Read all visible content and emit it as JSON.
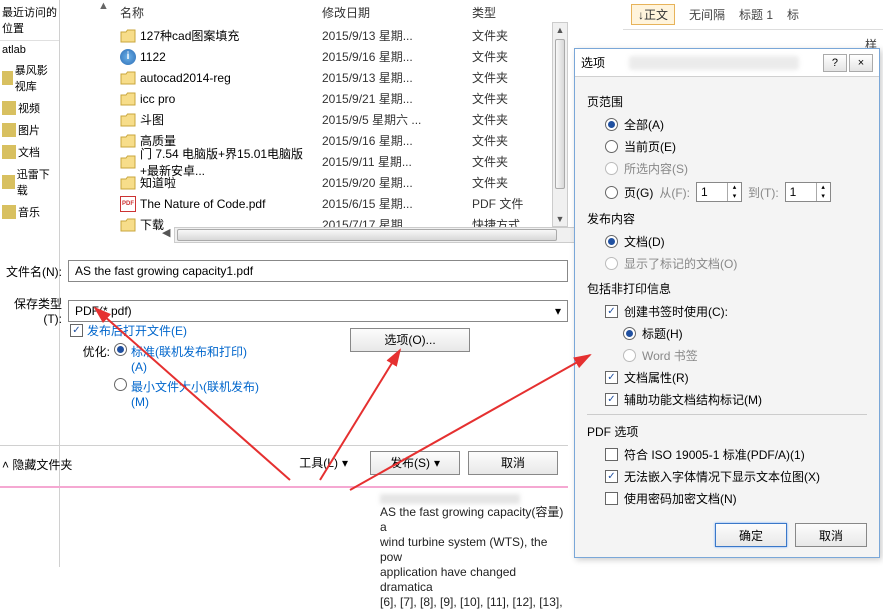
{
  "left_nav": {
    "header": "最近访问的位置",
    "items": [
      "atlab",
      "暴风影视库",
      "视频",
      "图片",
      "文档",
      "迅雷下载",
      "音乐"
    ]
  },
  "file_list": {
    "cols": {
      "name": "名称",
      "date": "修改日期",
      "type": "类型"
    },
    "rows": [
      {
        "name": "127种cad图案填充",
        "date": "2015/9/13 星期...",
        "type": "文件夹",
        "icon": "folder"
      },
      {
        "name": "1122",
        "date": "2015/9/16 星期...",
        "type": "文件夹",
        "icon": "info"
      },
      {
        "name": "autocad2014-reg",
        "date": "2015/9/13 星期...",
        "type": "文件夹",
        "icon": "folder"
      },
      {
        "name": "icc pro",
        "date": "2015/9/21 星期...",
        "type": "文件夹",
        "icon": "folder"
      },
      {
        "name": "斗图",
        "date": "2015/9/5 星期六 ...",
        "type": "文件夹",
        "icon": "folder"
      },
      {
        "name": "高质量",
        "date": "2015/9/16 星期...",
        "type": "文件夹",
        "icon": "folder"
      },
      {
        "name": "门 7.54 电脑版+界15.01电脑版+最新安卓...",
        "date": "2015/9/11 星期...",
        "type": "文件夹",
        "icon": "folder"
      },
      {
        "name": "知道啦",
        "date": "2015/9/20 星期...",
        "type": "文件夹",
        "icon": "folder"
      },
      {
        "name": "The Nature of Code.pdf",
        "date": "2015/6/15 星期...",
        "type": "PDF 文件",
        "icon": "pdf"
      },
      {
        "name": "下载",
        "date": "2015/7/17 星期",
        "type": "快捷方式",
        "icon": "folder"
      }
    ]
  },
  "filename": {
    "label": "文件名(N):",
    "value": "AS the fast growing capacity1.pdf"
  },
  "filetype": {
    "label": "保存类型(T):",
    "value": "PDF(*.pdf)"
  },
  "save_opts": {
    "open_after": "发布后打开文件(E)",
    "optimize_label": "优化:",
    "standard": "标准(联机发布和打印)(A)",
    "minsize": "最小文件大小(联机发布)(M)",
    "options_btn": "选项(O)..."
  },
  "bottom": {
    "hide_folders": "隐藏文件夹",
    "tools": "工具(L)",
    "publish": "发布(S)",
    "cancel": "取消"
  },
  "intro": "AS the fast growing capacity(容量) a\nwind turbine system (WTS), the pow\napplication have changed dramatica\n[6], [7], [8], [9], [10], [11], [12], [13],",
  "word_ribbon": {
    "zw": "↓正文",
    "items": [
      "无间隔",
      "标题 1",
      "标"
    ],
    "styles_label": "样"
  },
  "dialog": {
    "title": "选项",
    "win_help": "?",
    "win_close": "×",
    "page_range": {
      "title": "页范围",
      "all": "全部(A)",
      "current": "当前页(E)",
      "selection": "所选内容(S)",
      "pages": "页(G)",
      "from_lbl": "从(F):",
      "from_val": "1",
      "to_lbl": "到(T):",
      "to_val": "1"
    },
    "publish_content": {
      "title": "发布内容",
      "doc": "文档(D)",
      "marked": "显示了标记的文档(O)"
    },
    "nonprint": {
      "title": "包括非打印信息",
      "bookmarks": "创建书签时使用(C):",
      "headings": "标题(H)",
      "word_bm": "Word 书签",
      "props": "文档属性(R)",
      "acc": "辅助功能文档结构标记(M)"
    },
    "pdf_opts": {
      "title": "PDF 选项",
      "iso": "符合 ISO 19005-1 标准(PDF/A)(1)",
      "bitmap": "无法嵌入字体情况下显示文本位图(X)",
      "encrypt": "使用密码加密文档(N)"
    },
    "ok": "确定",
    "cancel": "取消"
  }
}
